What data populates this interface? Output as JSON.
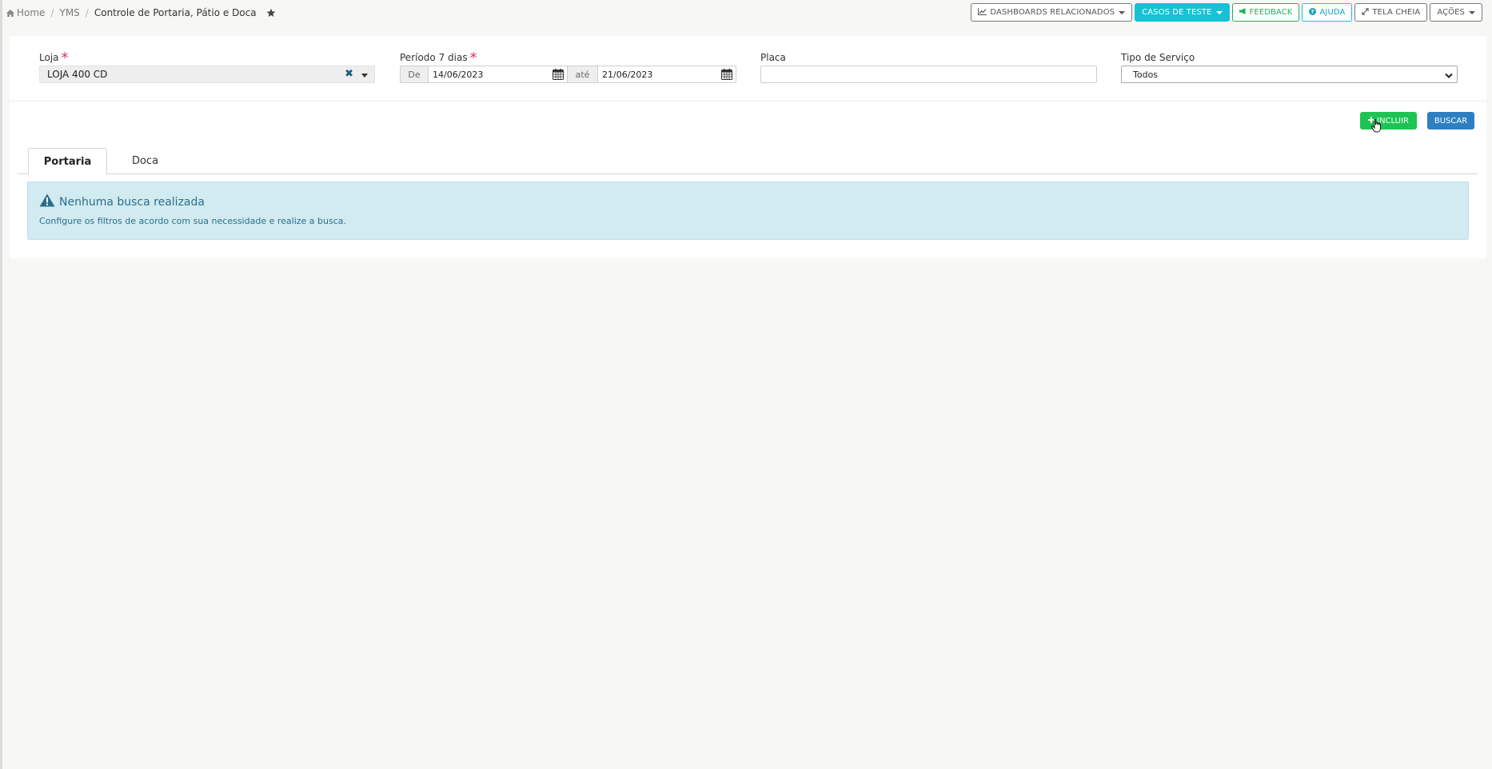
{
  "breadcrumb": {
    "home": "Home",
    "module": "YMS",
    "current": "Controle de Portaria, Pátio e Doca"
  },
  "top_actions": {
    "dashboards": "DASHBOARDS RELACIONADOS",
    "casos_teste": "CASOS DE TESTE",
    "feedback": "FEEDBACK",
    "ajuda": "AJUDA",
    "tela_cheia": "TELA CHEIA",
    "acoes": "AÇÕES"
  },
  "filters": {
    "loja": {
      "label": "Loja",
      "required": "*",
      "value": "LOJA 400 CD",
      "clear": "✖"
    },
    "periodo": {
      "label": "Período 7 dias",
      "required": "*",
      "de_label": "De",
      "de_value": "14/06/2023",
      "ate_label": "até",
      "ate_value": "21/06/2023"
    },
    "placa": {
      "label": "Placa",
      "value": ""
    },
    "tipo_servico": {
      "label": "Tipo de Serviço",
      "value": "Todos"
    }
  },
  "buttons": {
    "incluir": "INCLUIR",
    "buscar": "BUSCAR"
  },
  "tabs": [
    {
      "label": "Portaria",
      "active": true
    },
    {
      "label": "Doca",
      "active": false
    }
  ],
  "alert": {
    "title": "Nenhuma busca realizada",
    "message": "Configure os filtros de acordo com sua necessidade e realize a busca."
  },
  "colors": {
    "background": "#f7f7f5",
    "required": "#d6336c",
    "incluir": "#1ec453",
    "buscar": "#2d7fc1",
    "casos_teste": "#17c1d6",
    "alert_bg": "#d2ebf1",
    "alert_text": "#2a6f8a"
  }
}
